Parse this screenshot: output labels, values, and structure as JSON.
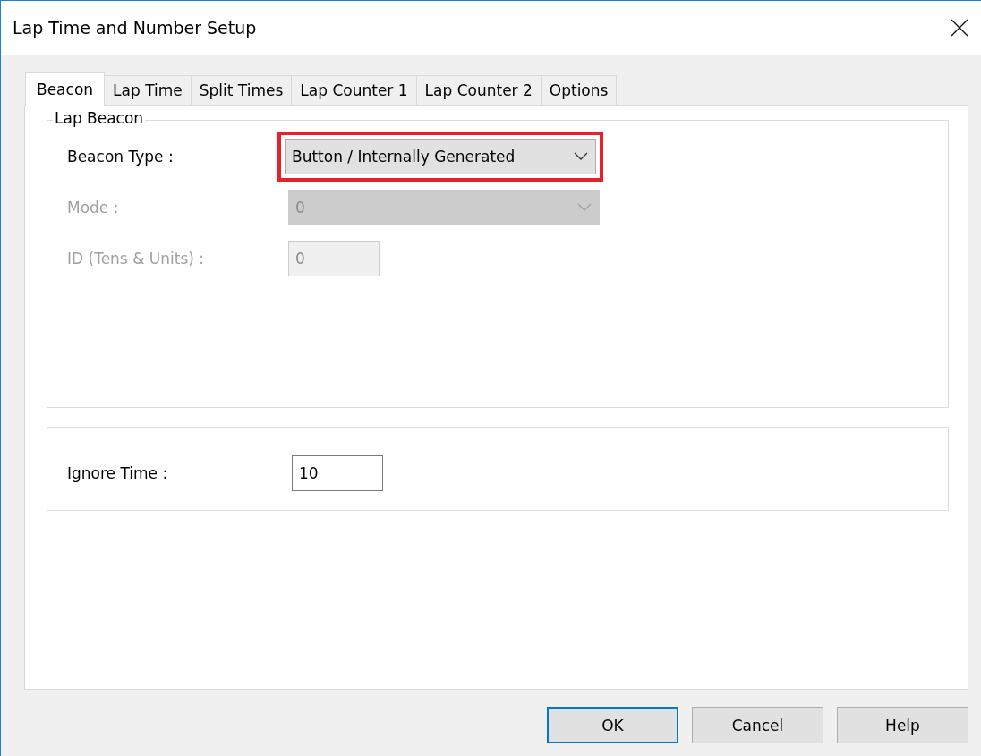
{
  "window": {
    "title": "Lap Time and Number Setup"
  },
  "tabs": [
    {
      "label": "Beacon",
      "selected": true
    },
    {
      "label": "Lap Time",
      "selected": false
    },
    {
      "label": "Split Times",
      "selected": false
    },
    {
      "label": "Lap Counter 1",
      "selected": false
    },
    {
      "label": "Lap Counter 2",
      "selected": false
    },
    {
      "label": "Options",
      "selected": false
    }
  ],
  "lap_beacon": {
    "title": "Lap Beacon",
    "fields": [
      {
        "kind": "dropdown",
        "label": "Beacon Type :",
        "value": "Button / Internally Generated",
        "disabled": false,
        "highlighted": true
      },
      {
        "kind": "dropdown",
        "label": "Mode :",
        "value": "0",
        "disabled": true
      },
      {
        "kind": "input",
        "label": "ID (Tens & Units) :",
        "value": "0",
        "disabled": true
      }
    ]
  },
  "timing": {
    "fields": [
      {
        "kind": "input",
        "label": "Ignore Time :",
        "value": "10",
        "disabled": false
      }
    ]
  },
  "buttons": [
    {
      "label": "OK",
      "default": true
    },
    {
      "label": "Cancel",
      "default": false
    },
    {
      "label": "Help",
      "default": false
    }
  ]
}
